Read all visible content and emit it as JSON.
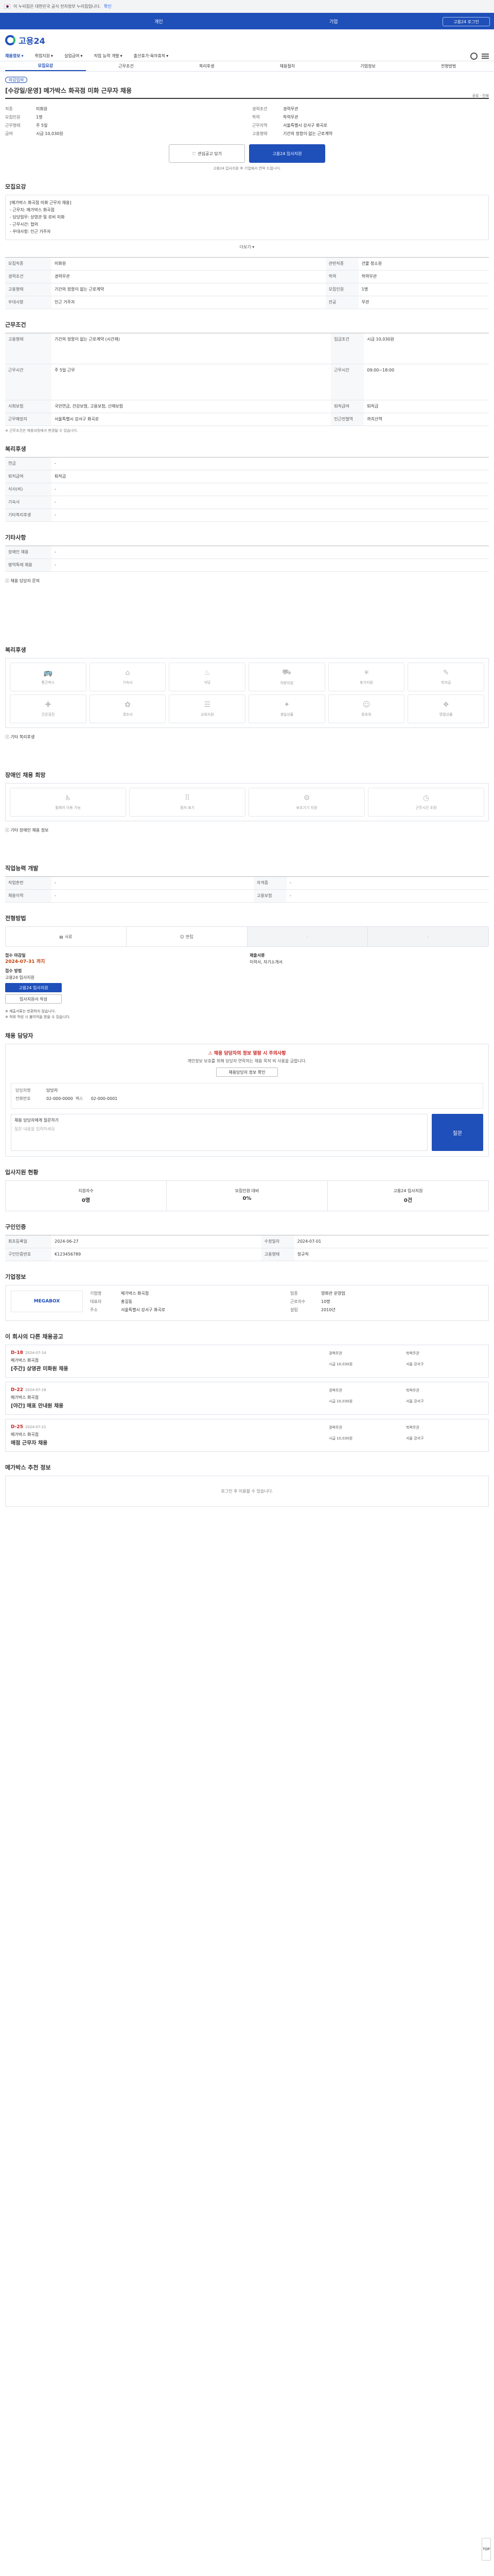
{
  "gov": {
    "text": "이 누리집은 대한민국 공식 전자정부 누리집입니다.",
    "link": "확인"
  },
  "top": {
    "left": "개인",
    "mid": "기업",
    "right": "고용24 로그인"
  },
  "brand": {
    "name": "고용24"
  },
  "gnb": [
    "채용정보",
    "취업지원",
    "실업급여",
    "직업 능력 개발",
    "출산휴가·육아휴직"
  ],
  "tabs": [
    "모집요강",
    "근무조건",
    "복리후생",
    "채용절차",
    "기업정보",
    "전형방법"
  ],
  "job": {
    "status": "마감임박",
    "title": "[수강일/운영] 메가박스 화곡점 미화 근무자 채용",
    "share": "공유 · 인쇄",
    "left": [
      [
        "직종",
        "미화원"
      ],
      [
        "모집인원",
        "1명"
      ],
      [
        "근무형태",
        "주 5일"
      ],
      [
        "급여",
        "시급 10,030원"
      ]
    ],
    "right": [
      [
        "경력조건",
        "경력무관"
      ],
      [
        "학력",
        "학력무관"
      ],
      [
        "근무지역",
        "서울특별시 강서구 화곡로"
      ],
      [
        "고용형태",
        "기간의 정함이 없는 근로계약"
      ]
    ]
  },
  "apply": {
    "save": "관심공고 담기",
    "apply": "고용24 입사지원",
    "note": "고용24 입사지원 후 기업에서 연락 드립니다."
  },
  "desc": {
    "title": "모집요강",
    "lines": [
      "[메가박스 화곡점 미화 근무자 채용]",
      "- 근무지: 메가박스 화곡점",
      "- 담당업무: 상영관 및 로비 미화",
      "- 근무시간: 협의",
      "- 우대사항: 인근 거주자"
    ],
    "more": "더보기"
  },
  "recruit": {
    "rows": [
      [
        "모집직종",
        "미화원",
        "관련직종",
        "건물 청소원"
      ],
      [
        "경력조건",
        "경력무관",
        "학력",
        "학력무관"
      ],
      [
        "고용형태",
        "기간의 정함이 없는 근로계약",
        "모집인원",
        "1명"
      ],
      [
        "우대사항",
        "인근 거주자",
        "전공",
        "무관"
      ]
    ]
  },
  "work": {
    "title": "근무조건",
    "rows": [
      [
        "고용형태",
        "기간의 정함이 없는 근로계약 (시간제)",
        "임금조건",
        "시급 10,030원"
      ],
      [
        "근무시간",
        "주 5일 근무",
        "근무시간",
        "09:00~18:00"
      ],
      [
        "사회보험",
        "국민연금, 건강보험, 고용보험, 산재보험",
        "퇴직급여",
        "퇴직금"
      ],
      [
        "근무예정지",
        "서울특별시 강서구 화곡로",
        "인근전철역",
        "까치산역"
      ]
    ],
    "note": "※ 근무조건은 채용과정에서 변경될 수 있습니다."
  },
  "welfare": {
    "title": "복리후생",
    "rows": [
      [
        "연금",
        "-"
      ],
      [
        "퇴직급여",
        "퇴직금"
      ],
      [
        "식사(비)",
        "-"
      ],
      [
        "기숙사",
        "-"
      ],
      [
        "기타복리후생",
        "-"
      ]
    ]
  },
  "extra": {
    "title": "기타사항",
    "rows": [
      [
        "장애인 채용",
        "-"
      ],
      [
        "병역특례 채용",
        "-"
      ]
    ],
    "more": "채용 담당자 문의"
  },
  "icons": {
    "title": "복리후생",
    "items": [
      "통근버스",
      "기숙사",
      "식당",
      "차량지원",
      "휴가지원",
      "학자금",
      "건강검진",
      "경조사",
      "교육지원",
      "생일선물",
      "동호회",
      "명절선물"
    ],
    "note": "기타 복리후생"
  },
  "barrier": {
    "title": "장애인 채용 희망",
    "items": [
      "휠체어 이동 가능",
      "점자 표기",
      "보조기기 지원",
      "근무시간 조정"
    ],
    "note": "기타 장애인 채용 정보"
  },
  "dev": {
    "title": "직업능력 개발",
    "rows": [
      [
        "직업훈련",
        "-",
        "자격증",
        "-"
      ],
      [
        "채용이력",
        "-",
        "고용보험",
        "-"
      ]
    ]
  },
  "method": {
    "title": "전형방법",
    "tabs": [
      "서류",
      "면접",
      "-",
      "-"
    ]
  },
  "proc": {
    "deadline_k": "접수 마감일",
    "deadline": "2024-07-31 까지",
    "method_k": "접수 방법",
    "method": "고용24 입사지원",
    "apply": "고용24 입사지원",
    "docs_k": "제출서류",
    "docs": "이력서, 자기소개서",
    "print": "입사지원서 작성"
  },
  "notes": [
    "※ 제출서류는 반환하지 않습니다.",
    "※ 허위 작성 시 불이익을 받을 수 있습니다."
  ],
  "mgr": {
    "title": "채용 담당자",
    "alert": "채용 담당자의 정보 열람 시 주의사항",
    "body": "개인정보 보호를 위해 담당자 연락처는 채용 목적 외 사용을 금합니다.",
    "btn": "채용담당자 정보 확인",
    "name_k": "담당자명",
    "name": "담당자",
    "tel_k": "전화번호",
    "tel": "02-000-0000",
    "fax_k": "팩스",
    "fax": "02-000-0001",
    "q": "채용 담당자에게 질문하기",
    "q_ph": "질문 내용을 입력하세요",
    "q_btn": "질문"
  },
  "stats": {
    "title": "입사지원 현황",
    "items": [
      [
        "지원자수",
        "0명"
      ],
      [
        "모집인원 대비",
        "0%"
      ],
      [
        "고용24 입사지원",
        "0건"
      ]
    ]
  },
  "reg": {
    "title": "구인인증",
    "rows": [
      [
        "최초등록일",
        "2024-06-27",
        "수정일자",
        "2024-07-01"
      ],
      [
        "구인인증번호",
        "K123456789",
        "고용형태",
        "정규직"
      ]
    ]
  },
  "company": {
    "title": "기업정보",
    "logo": "MEGABOX",
    "rows": [
      [
        "기업명",
        "메가박스 화곡점"
      ],
      [
        "업종",
        "영화관 운영업"
      ],
      [
        "대표자",
        "홍길동"
      ],
      [
        "근로자수",
        "10명"
      ],
      [
        "주소",
        "서울특별시 강서구 화곡로"
      ],
      [
        "설립",
        "2010년"
      ]
    ]
  },
  "similar": {
    "title": "이 회사의 다른 채용공고",
    "items": [
      {
        "dday": "D-18",
        "date": "2024-07-14",
        "name": "메가박스 화곡점",
        "job": "[주간] 상영관 미화원 채용",
        "info": [
          "경력무관",
          "학력무관",
          "시급 10,030원",
          "서울 강서구"
        ]
      },
      {
        "dday": "D-22",
        "date": "2024-07-18",
        "name": "메가박스 화곡점",
        "job": "[야간] 매표 안내원 채용",
        "info": [
          "경력무관",
          "학력무관",
          "시급 10,030원",
          "서울 강서구"
        ]
      },
      {
        "dday": "D-25",
        "date": "2024-07-21",
        "name": "메가박스 화곡점",
        "job": "매점 근무자 채용",
        "info": [
          "경력무관",
          "학력무관",
          "시급 10,030원",
          "서울 강서구"
        ]
      }
    ]
  },
  "login": {
    "title": "메가박스 추천 정보",
    "text": "로그인 후 이용할 수 있습니다."
  },
  "top_btn": "TOP"
}
